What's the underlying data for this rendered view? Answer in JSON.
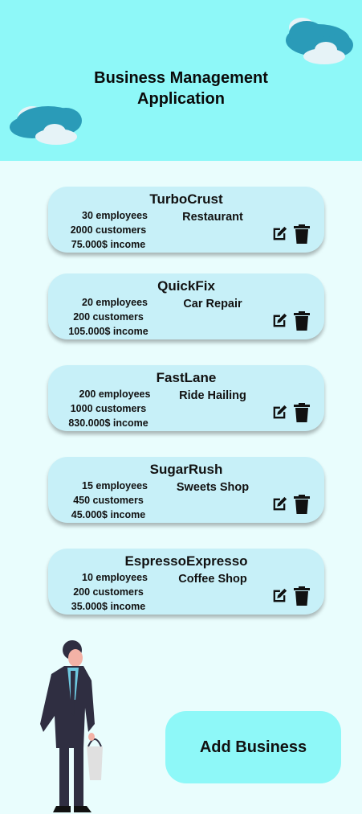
{
  "header": {
    "title_line1": "Business Management",
    "title_line2": "Application"
  },
  "businesses": [
    {
      "name": "TurboCrust",
      "employees": "30 employees",
      "customers": "2000 customers",
      "income": "75.000$ income",
      "type": "Restaurant"
    },
    {
      "name": "QuickFix",
      "employees": "20 employees",
      "customers": "200 customers",
      "income": "105.000$ income",
      "type": "Car Repair"
    },
    {
      "name": "FastLane",
      "employees": "200 employees",
      "customers": "1000 customers",
      "income": "830.000$ income",
      "type": "Ride Hailing"
    },
    {
      "name": "SugarRush",
      "employees": "15 employees",
      "customers": "450 customers",
      "income": "45.000$ income",
      "type": "Sweets Shop"
    },
    {
      "name": "EspressoExpresso",
      "employees": "10 employees",
      "customers": "200 customers",
      "income": "35.000$ income",
      "type": "Coffee Shop"
    }
  ],
  "actions": {
    "add_business_label": "Add Business",
    "edit_icon": "edit-icon",
    "delete_icon": "trash-icon"
  },
  "colors": {
    "header_bg": "#8ef8f8",
    "page_bg": "#e9fdfd",
    "card_bg": "#c7f0f8",
    "button_bg": "#8ef8f8"
  }
}
